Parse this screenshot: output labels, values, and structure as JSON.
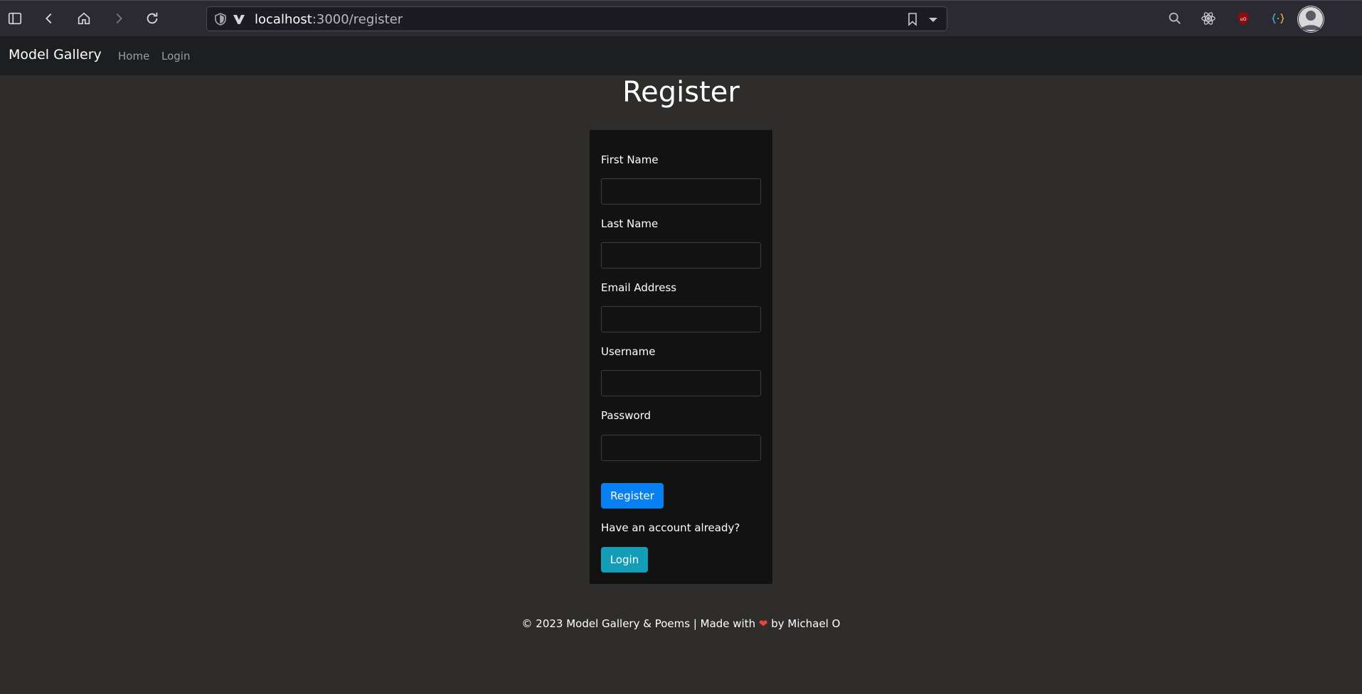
{
  "browser": {
    "url_host": "localhost",
    "url_path": ":3000/register"
  },
  "navbar": {
    "brand": "Model Gallery",
    "links": [
      "Home",
      "Login"
    ]
  },
  "page": {
    "title": "Register"
  },
  "form": {
    "fields": [
      {
        "label": "First Name",
        "value": ""
      },
      {
        "label": "Last Name",
        "value": ""
      },
      {
        "label": "Email Address",
        "value": ""
      },
      {
        "label": "Username",
        "value": ""
      },
      {
        "label": "Password",
        "value": ""
      }
    ],
    "register_button": "Register",
    "have_account_text": "Have an account already?",
    "login_button": "Login"
  },
  "footer": {
    "prefix": "© 2023 Model Gallery & Poems | Made with",
    "heart": "❤",
    "suffix": "by Michael O"
  },
  "colors": {
    "primary_button": "#087ff3",
    "info_button": "#149db7",
    "heart": "#e8453c"
  }
}
